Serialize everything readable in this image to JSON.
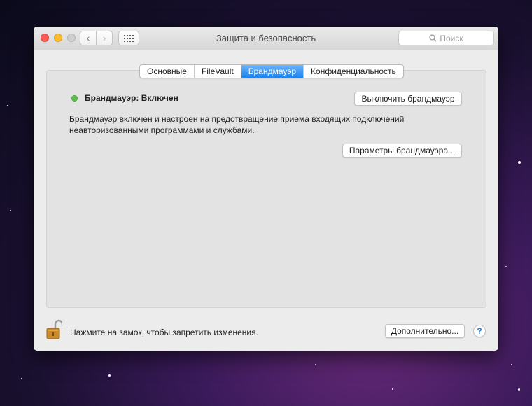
{
  "window": {
    "title": "Защита и безопасность",
    "search_placeholder": "Поиск"
  },
  "tabs": [
    {
      "label": "Основные",
      "active": false
    },
    {
      "label": "FileVault",
      "active": false
    },
    {
      "label": "Брандмауэр",
      "active": true
    },
    {
      "label": "Конфиденциальность",
      "active": false
    }
  ],
  "firewall": {
    "status_label": "Брандмауэр: Включен",
    "status_color": "#5ec24a",
    "toggle_button": "Выключить брандмауэр",
    "description_line1": "Брандмауэр включен и настроен на предотвращение приема входящих подключений",
    "description_line2": "неавторизованными программами и службами.",
    "options_button": "Параметры брандмауэра..."
  },
  "footer": {
    "lock_text": "Нажмите на замок, чтобы запретить изменения.",
    "advanced_button": "Дополнительно...",
    "help_label": "?"
  },
  "colors": {
    "accent": "#1b83f0"
  }
}
